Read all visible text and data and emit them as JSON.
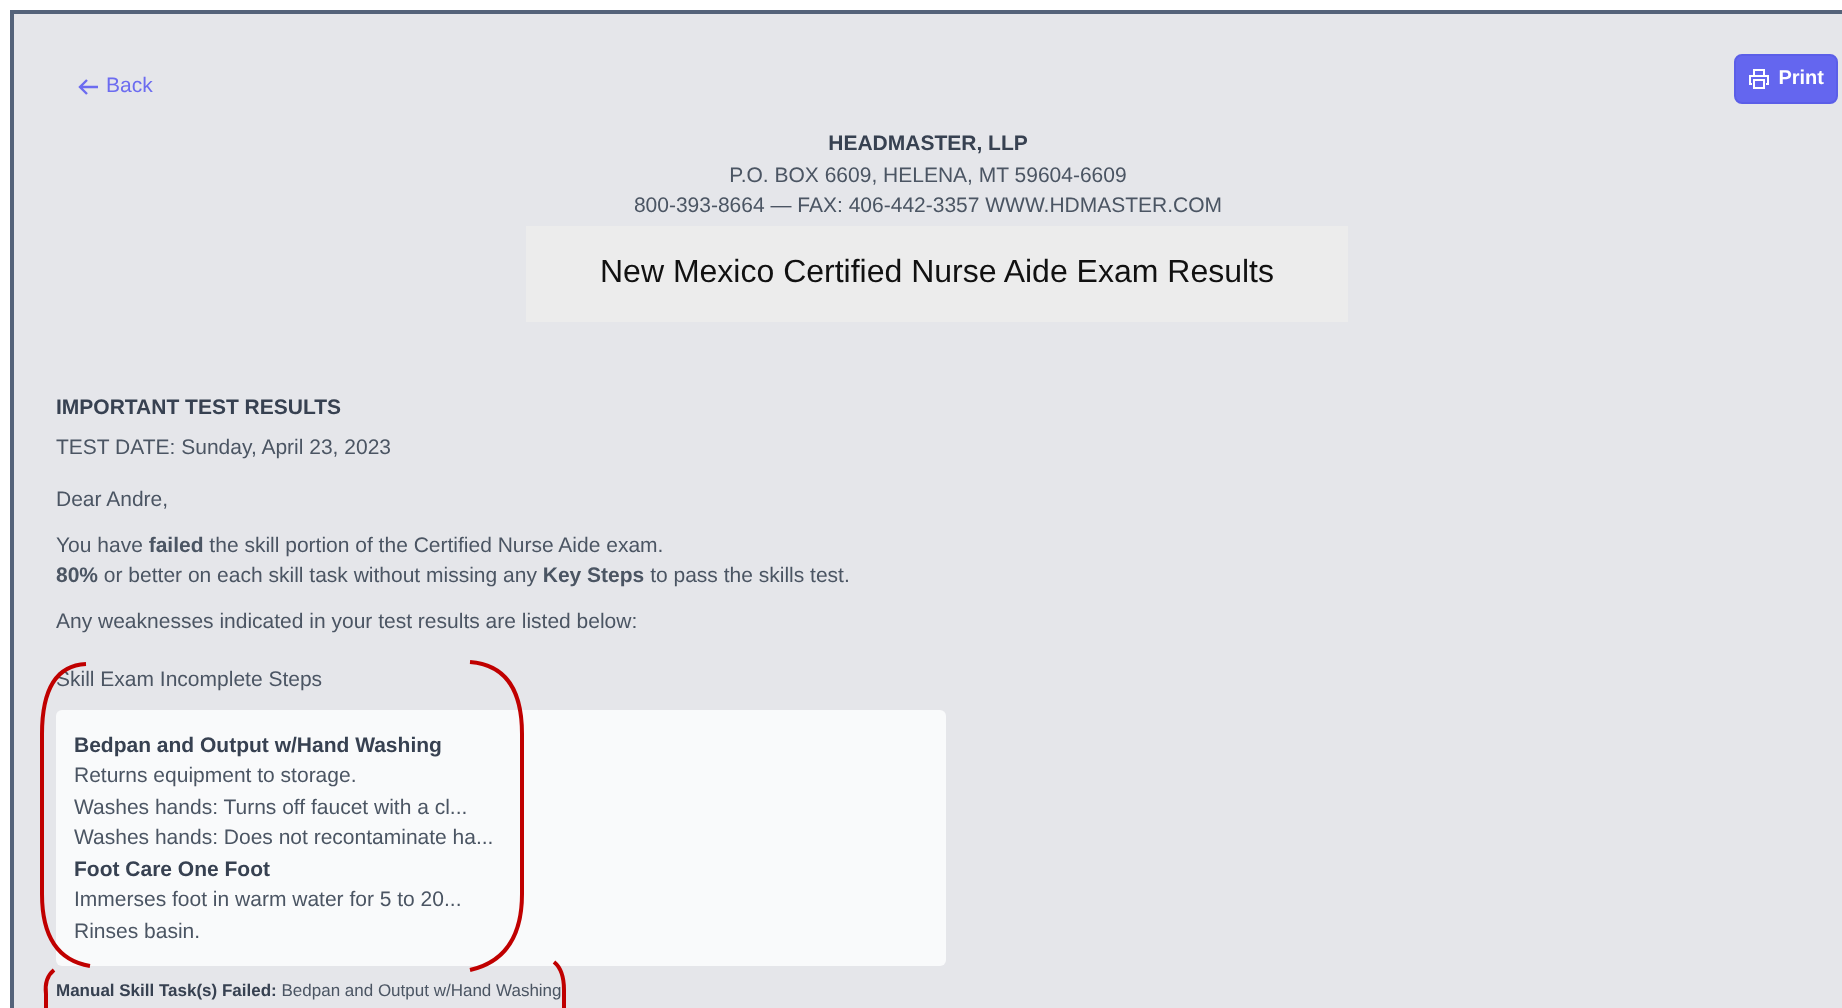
{
  "back_link": {
    "label": "Back"
  },
  "print_button": {
    "label": "Print"
  },
  "letterhead": {
    "company": "HEADMASTER, LLP",
    "address": "P.O. BOX 6609, HELENA, MT 59604-6609",
    "contact": "800-393-8664 — FAX: 406-442-3357 WWW.HDMASTER.COM"
  },
  "title": "New Mexico Certified Nurse Aide Exam Results",
  "heading": "IMPORTANT TEST RESULTS",
  "test_date": "TEST DATE: Sunday, April 23, 2023",
  "greeting": "Dear Andre,",
  "result_lines": [
    "You have **failed** the skill portion of the Certified Nurse Aide exam.",
    "**80%** or better on each skill task without missing any **Key Steps** to pass the skills test."
  ],
  "weakness_intro": "Any weaknesses indicated in your test results are listed below:",
  "steps_section": {
    "title": "Skill Exam Incomplete Steps",
    "items": [
      {
        "kind": "task",
        "text": "Bedpan and Output w/Hand Washing"
      },
      {
        "kind": "step",
        "text": "Returns equipment to storage."
      },
      {
        "kind": "step",
        "text": "Washes hands: Turns off faucet with a cl..."
      },
      {
        "kind": "step",
        "text": "Washes hands: Does not recontaminate ha..."
      },
      {
        "kind": "task",
        "text": "Foot Care One Foot"
      },
      {
        "kind": "step",
        "text": "Immerses foot in warm water for 5 to 20..."
      },
      {
        "kind": "step",
        "text": "Rinses basin."
      }
    ]
  },
  "failed_summary": "**Manual Skill Task(s) Failed:** Bedpan and Output w/Hand Washing"
}
